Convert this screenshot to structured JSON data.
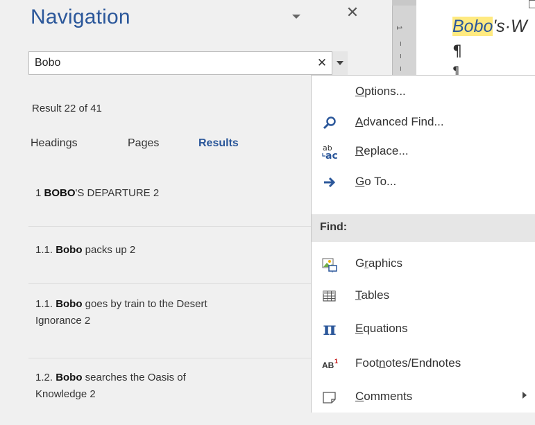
{
  "nav": {
    "title": "Navigation",
    "search_value": "Bobo",
    "result_count": "Result 22 of 41",
    "tabs": {
      "headings": "Headings",
      "pages": "Pages",
      "results": "Results"
    },
    "results": [
      {
        "prefix": "1 ",
        "bold": "BOBO",
        "suffix": "'S DEPARTURE 2"
      },
      {
        "prefix": "1.1. ",
        "bold": "Bobo",
        "suffix": " packs up 2"
      },
      {
        "prefix": "1.1. ",
        "bold": "Bobo",
        "suffix": " goes by train to the Desert",
        "line2": "Ignorance 2"
      },
      {
        "prefix": "1.2. ",
        "bold": "Bobo",
        "suffix": " searches the Oasis of",
        "line2": "Knowledge 2"
      }
    ]
  },
  "document": {
    "highlight": "Bobo",
    "rest": "'s·W",
    "pilcrow": "¶",
    "ruler_label": "1"
  },
  "menu": {
    "options": {
      "pre": "",
      "key": "O",
      "post": "ptions..."
    },
    "advanced_find": {
      "pre": "",
      "key": "A",
      "post": "dvanced Find..."
    },
    "replace": {
      "pre": "",
      "key": "R",
      "post": "eplace..."
    },
    "go_to": {
      "pre": "",
      "key": "G",
      "post": "o To..."
    },
    "find_header": "Find:",
    "graphics": {
      "pre": "G",
      "key": "r",
      "post": "aphics"
    },
    "tables": {
      "pre": "",
      "key": "T",
      "post": "ables"
    },
    "equations": {
      "pre": "",
      "key": "E",
      "post": "quations"
    },
    "footnotes": {
      "pre": "Foot",
      "key": "n",
      "post": "otes/Endnotes"
    },
    "comments": {
      "pre": "",
      "key": "C",
      "post": "omments"
    }
  },
  "colors": {
    "accent": "#2b579a",
    "highlight": "#ffea80",
    "footnote_red": "#c00000"
  },
  "icons": {
    "advanced_find": "magnifier-icon",
    "replace": "replace-icon",
    "go_to": "arrow-right-icon",
    "graphics": "graphics-icon",
    "tables": "table-icon",
    "equations": "pi-icon",
    "footnotes": "footnote-icon",
    "comments": "comment-icon"
  }
}
